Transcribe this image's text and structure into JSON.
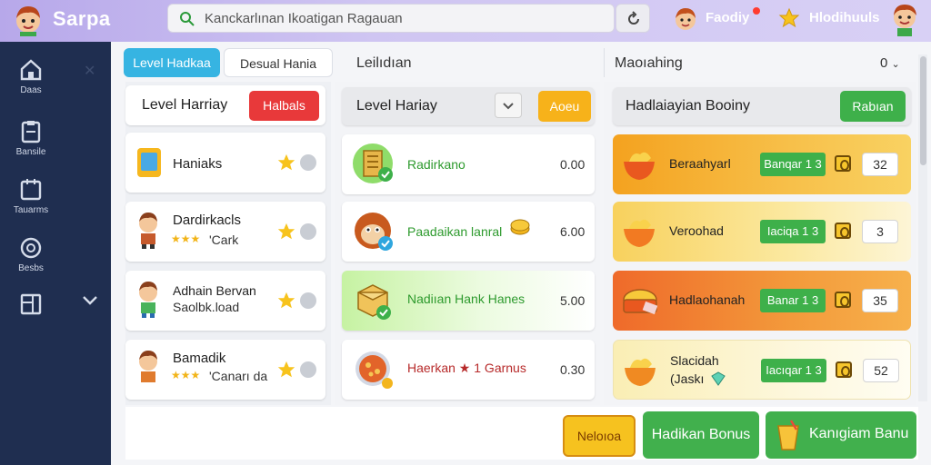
{
  "app": {
    "brand": "Sarpa"
  },
  "search": {
    "text": "Kanckarlınan Ikoatigan Ragauan"
  },
  "top_bar": {
    "user_name": "Faodiy",
    "achievements_label": "Hlodihuuls"
  },
  "sidebar": {
    "items": [
      {
        "label": "Daas",
        "icon": "home-icon"
      },
      {
        "label": "Bansile",
        "icon": "document-icon"
      },
      {
        "label": "Tauarms",
        "icon": "calendar-icon"
      },
      {
        "label": "Besbs",
        "icon": "coin-icon"
      },
      {
        "label": "",
        "icon": "layout-icon"
      }
    ]
  },
  "tabs": [
    {
      "label": "Level Hadkaa",
      "active": true
    },
    {
      "label": "Desual Hania",
      "active": false
    }
  ],
  "columns": {
    "middle_header": "Leilıdıan",
    "right_header": "Maoıahing",
    "right_header_value": "0"
  },
  "left_panel": {
    "header": "Level Harriay",
    "button": "Halbals",
    "items": [
      {
        "name": "Haniaks",
        "sub": "",
        "icon": "tablet-icon"
      },
      {
        "name": "Dardirkacls",
        "sub": "'Cark",
        "icon": "avatar-boy-icon"
      },
      {
        "name": "Adhain Bervan",
        "sub": "Saolbk.load",
        "icon": "avatar-green-icon"
      },
      {
        "name": "Bamadik",
        "sub": "'Canarı da",
        "icon": "avatar-boy2-icon"
      }
    ]
  },
  "middle_panel": {
    "header": "Level Hariay",
    "button": "Aoeu",
    "items": [
      {
        "name": "Radirkano",
        "value": "0.00",
        "icon": "building-check-icon",
        "highlight": false
      },
      {
        "name": "Paadaikan lanral",
        "value": "6.00",
        "icon": "monkey-check-icon",
        "highlight": false
      },
      {
        "name": "Nadiıan Hank Hanes",
        "value": "5.00",
        "icon": "box-check-icon",
        "highlight": true
      },
      {
        "name": "Haerkan ★ 1 Garnus",
        "value": "0.30",
        "icon": "pizza-icon",
        "highlight": false
      }
    ]
  },
  "right_panel": {
    "header": "Hadlaiayian Booiny",
    "button": "Rabıan",
    "items": [
      {
        "name": "Beraahyarl",
        "sub": "",
        "tag": "Banqar 1 3",
        "value": "32",
        "color": "#f5a727"
      },
      {
        "name": "Veroohad",
        "sub": "",
        "tag": "Iaciqa 1 3",
        "value": "3",
        "color": "#f9d96a"
      },
      {
        "name": "Hadlaohanah",
        "sub": "",
        "tag": "Banar 1 3",
        "value": "35",
        "color": "#f07f32"
      },
      {
        "name": "Slacidah",
        "sub": "(Jaskı",
        "tag": "Iacıqar 1 3",
        "value": "52",
        "color": "#f9ecb0"
      }
    ]
  },
  "bottom": {
    "btn1": "Neloıoa",
    "btn2": "Hadikan Bonus",
    "btn3": "Kanıgiam Banu"
  }
}
